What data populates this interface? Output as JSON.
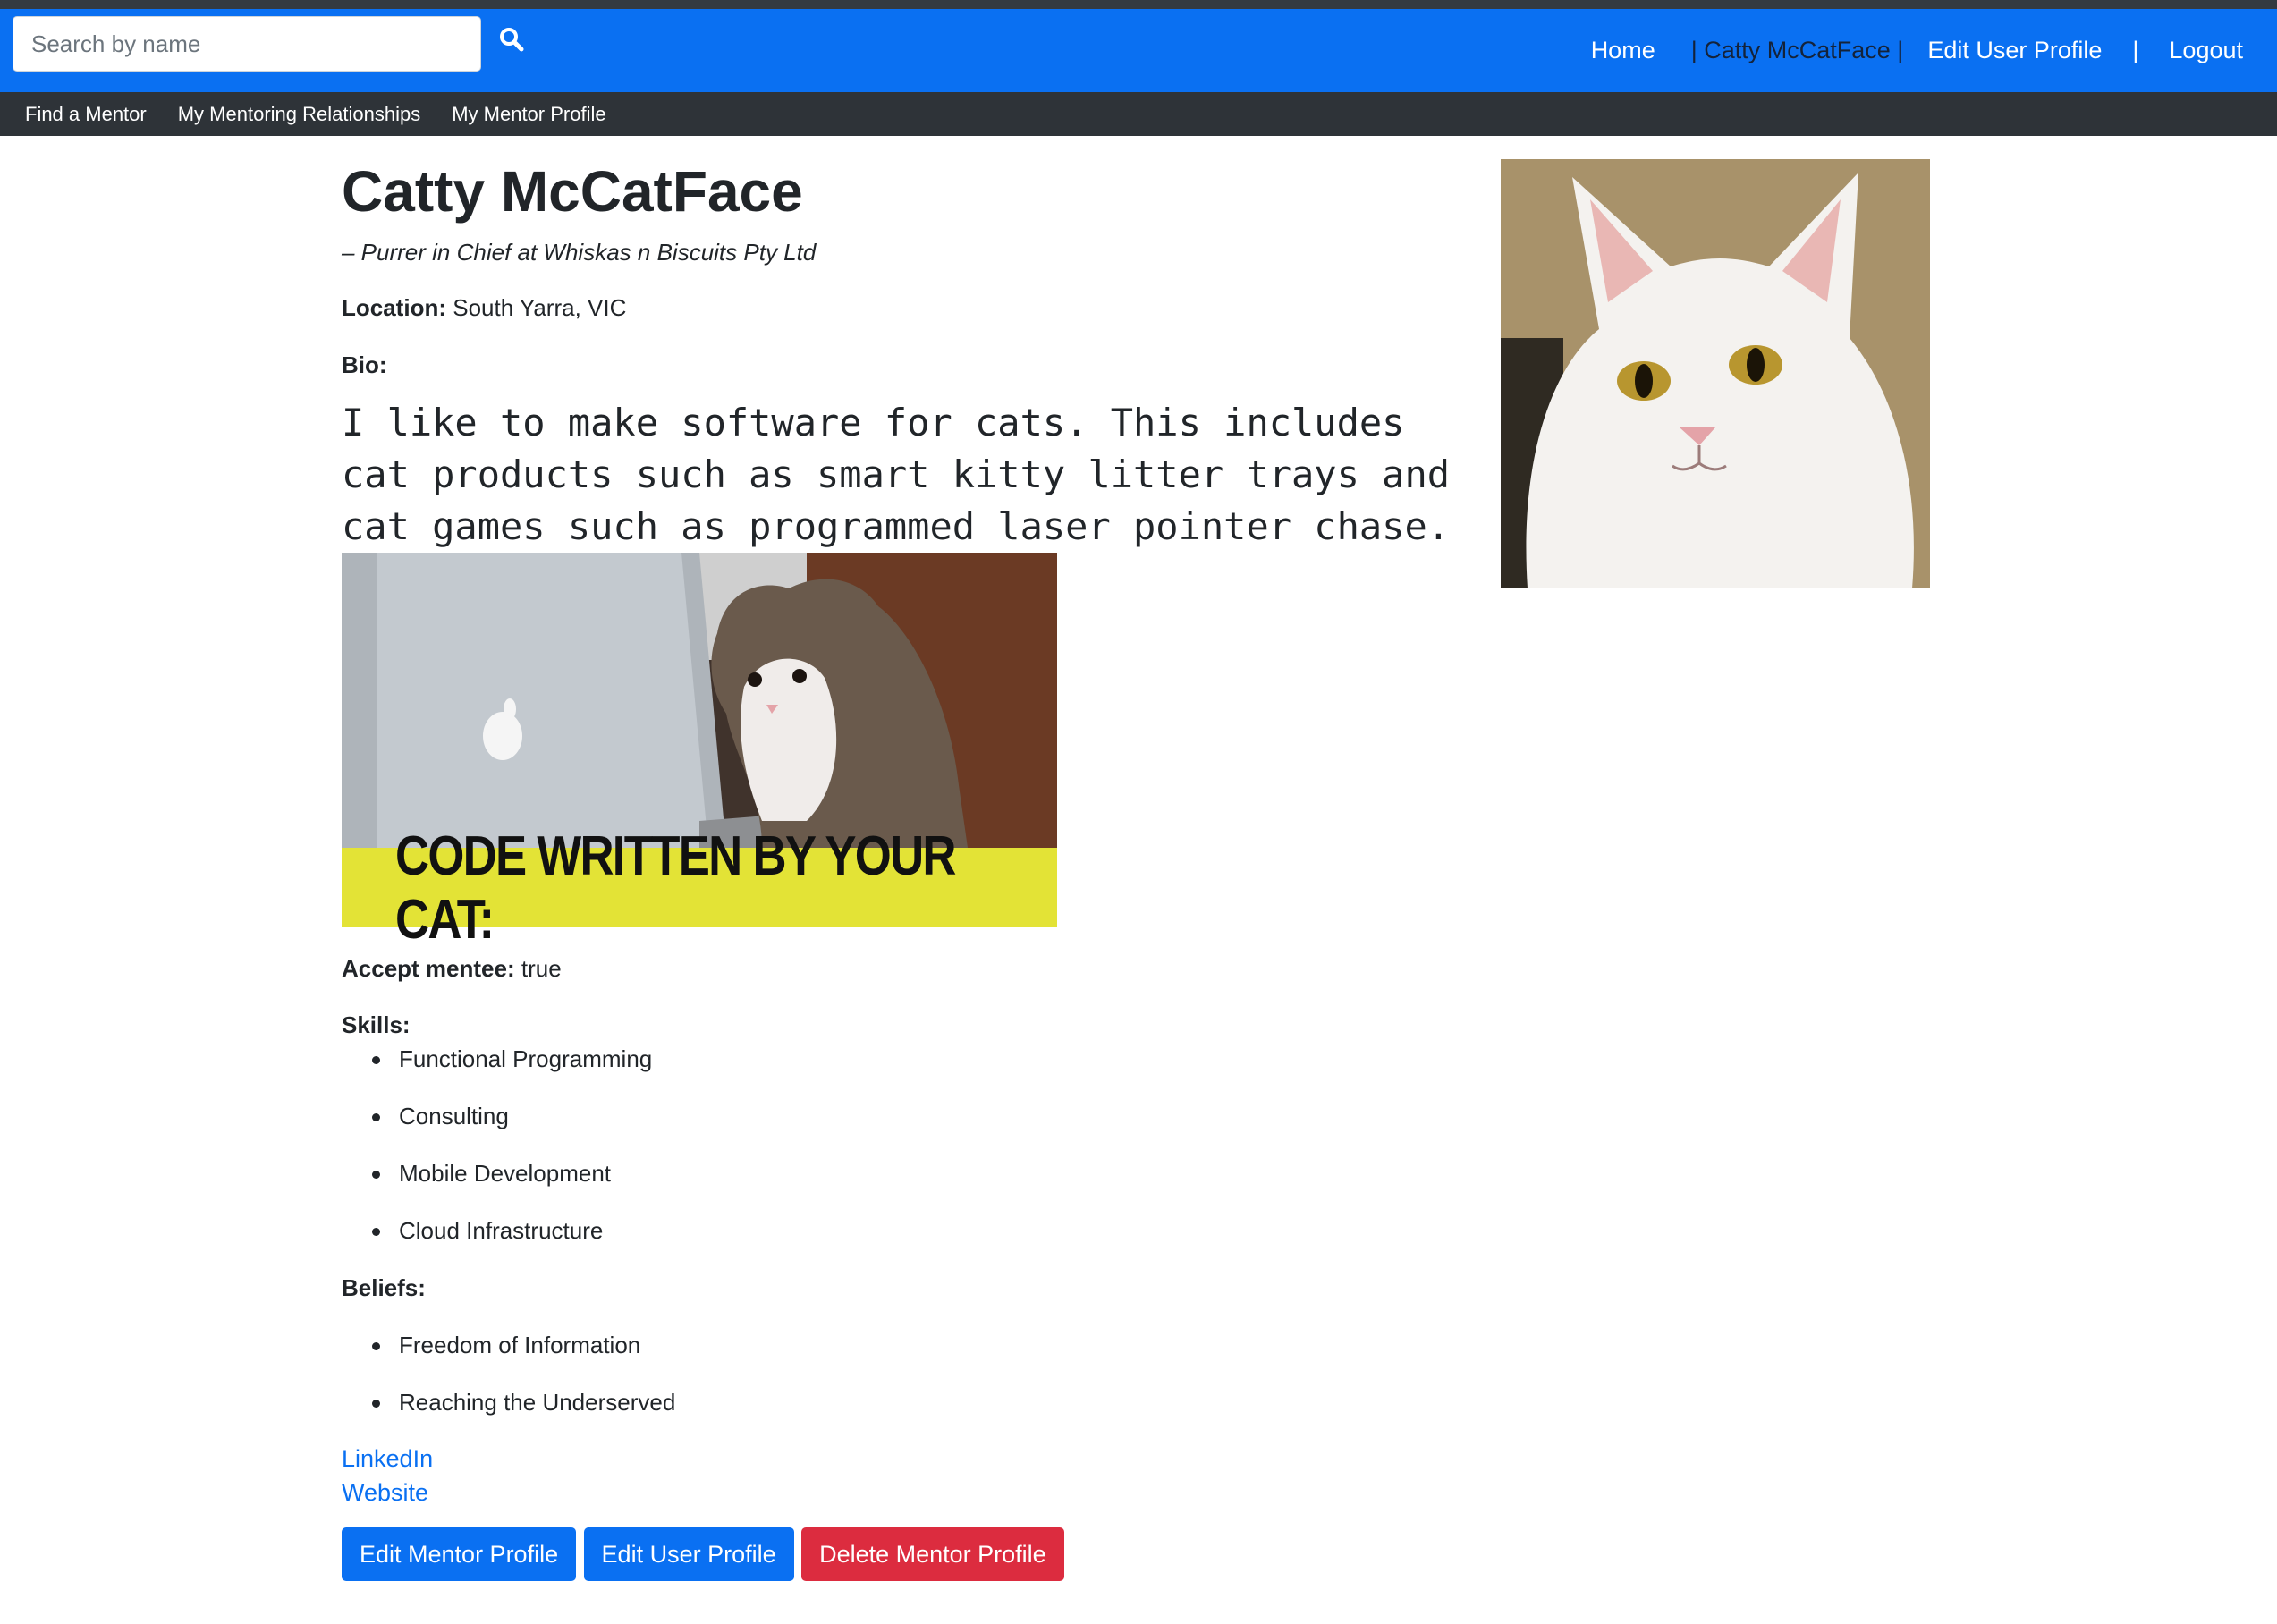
{
  "search": {
    "placeholder": "Search by name"
  },
  "nav": {
    "home": "Home",
    "current_user": "| Catty McCatFace |",
    "edit_user_profile": "Edit User Profile",
    "separator": "|",
    "logout": "Logout"
  },
  "subnav": {
    "items": [
      "Find a Mentor",
      "My Mentoring Relationships",
      "My Mentor Profile"
    ]
  },
  "profile": {
    "name": "Catty McCatFace",
    "tagline": "– Purrer in Chief at Whiskas n Biscuits Pty Ltd",
    "location_label": "Location:",
    "location": "South Yarra, VIC",
    "bio_label": "Bio:",
    "bio": "I like to make software for cats. This includes cat products such as smart kitty litter trays and cat games such as programmed laser pointer chase.",
    "bio_image_caption": "CODE WRITTEN BY YOUR CAT:",
    "accept_mentee_label": "Accept mentee:",
    "accept_mentee": "true",
    "skills_label": "Skills:",
    "skills": [
      "Functional Programming",
      "Consulting",
      "Mobile Development",
      "Cloud Infrastructure"
    ],
    "beliefs_label": "Beliefs:",
    "beliefs": [
      "Freedom of Information",
      "Reaching the Underserved"
    ],
    "links": {
      "linkedin": "LinkedIn",
      "website": "Website"
    }
  },
  "actions": {
    "edit_mentor_profile": "Edit Mentor Profile",
    "edit_user_profile": "Edit User Profile",
    "delete_mentor_profile": "Delete Mentor Profile"
  },
  "colors": {
    "navbar": "#0a70f2",
    "subnav": "#2e3338",
    "primary": "#0a70f2",
    "danger": "#dc2c3f",
    "caption_banner": "#e3e336"
  }
}
